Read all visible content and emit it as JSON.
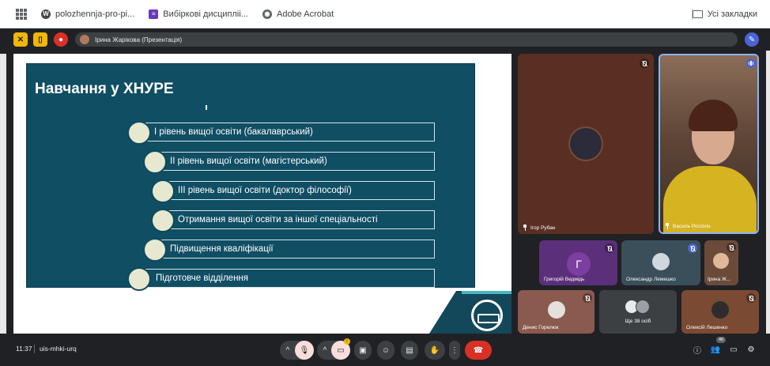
{
  "bookmarks": {
    "items": [
      {
        "label": "polozhennja-pro-pi...",
        "icon": "wordpress-icon",
        "color": "#3c4043"
      },
      {
        "label": "Вибіркові дисципліі...",
        "icon": "form-icon",
        "color": "#673ab7"
      },
      {
        "label": "Adobe Acrobat",
        "icon": "globe-icon",
        "color": "#5f6368"
      }
    ],
    "all_bookmarks": "Усі закладки"
  },
  "meet_header": {
    "presenter": "Ірина Жарікова (Презентація)"
  },
  "slide": {
    "title": "Навчання у  ХНУРЕ",
    "items": [
      "І рівень вищої освіти (бакалаврський)",
      "ІІ рівень вищої освіти (магістерський)",
      "ІІІ рівень вищої освіти (доктор філософії)",
      "Отримання вищої освіти за іншої спеціальності",
      "Підвищення кваліфікації",
      "Підготовче відділення"
    ]
  },
  "participants": {
    "main": [
      {
        "name": "Ігор Рубан",
        "mic": "muted"
      },
      {
        "name": "Василь Россіхін",
        "mic": "speaking"
      }
    ],
    "small": [
      {
        "name": "Григорій Ведмідь",
        "initial": "Г",
        "mic": "muted"
      },
      {
        "name": "Олександр Лемешко",
        "mic": "muted"
      },
      {
        "name": "Ірина Ж...",
        "mic": "muted"
      },
      {
        "name": "Денис Горелюк",
        "mic": "muted"
      },
      {
        "name": "Ще 38 осіб"
      },
      {
        "name": "Олексій Лешенко",
        "mic": "muted"
      }
    ]
  },
  "bottom_bar": {
    "time": "11:37",
    "meeting_code": "uis-mhki-urq",
    "participant_count": "46",
    "camera_badge": "!"
  },
  "colors": {
    "slide_bg": "#104e64",
    "end_call": "#d93025",
    "mic_active_bg": "#f9dedc",
    "purple_tile": "#7b3fa0"
  }
}
